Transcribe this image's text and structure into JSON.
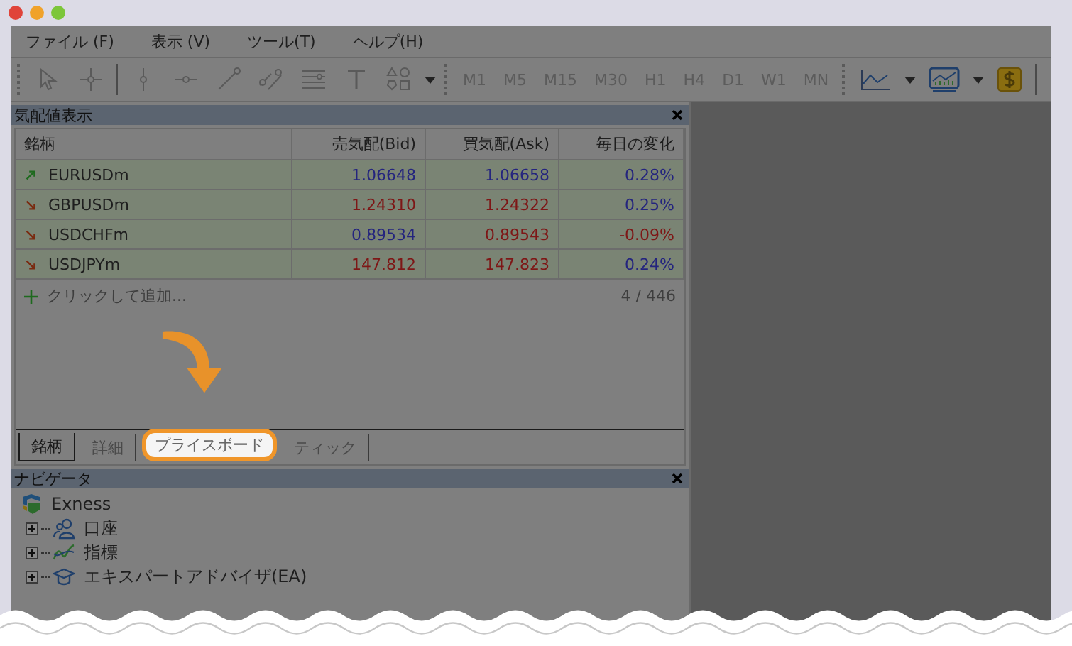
{
  "menu": [
    "ファイル (F)",
    "表示 (V)",
    "ツール(T)",
    "ヘルプ(H)"
  ],
  "toolbar": {
    "timeframes": [
      "M1",
      "M5",
      "M15",
      "M30",
      "H1",
      "H4",
      "D1",
      "W1",
      "MN"
    ]
  },
  "market_watch": {
    "title": "気配値表示",
    "columns": [
      "銘柄",
      "売気配(Bid)",
      "買気配(Ask)",
      "毎日の変化"
    ],
    "rows": [
      {
        "symbol": "EURUSDm",
        "rising": true,
        "bid": {
          "text": "1.06648",
          "rising": true
        },
        "ask": {
          "text": "1.06658",
          "rising": true
        },
        "change": {
          "text": "0.28%",
          "rising": true
        }
      },
      {
        "symbol": "GBPUSDm",
        "rising": false,
        "bid": {
          "text": "1.24310",
          "rising": false
        },
        "ask": {
          "text": "1.24322",
          "rising": false
        },
        "change": {
          "text": "0.25%",
          "rising": true
        }
      },
      {
        "symbol": "USDCHFm",
        "rising": false,
        "bid": {
          "text": "0.89534",
          "rising": true
        },
        "ask": {
          "text": "0.89543",
          "rising": false
        },
        "change": {
          "text": "-0.09%",
          "rising": false
        }
      },
      {
        "symbol": "USDJPYm",
        "rising": false,
        "bid": {
          "text": "147.812",
          "rising": false
        },
        "ask": {
          "text": "147.823",
          "rising": false
        },
        "change": {
          "text": "0.24%",
          "rising": true
        }
      }
    ],
    "add_label": "クリックして追加...",
    "count": "4 / 446",
    "tabs": [
      {
        "label": "銘柄",
        "selected": true,
        "highlighted": false
      },
      {
        "label": "詳細",
        "selected": false,
        "highlighted": false
      },
      {
        "label": "プライスボード",
        "selected": false,
        "highlighted": true
      },
      {
        "label": "ティック",
        "selected": false,
        "highlighted": false
      }
    ]
  },
  "navigator": {
    "title": "ナビゲータ",
    "root": "Exness",
    "children": [
      {
        "label": "口座",
        "kind": "accounts",
        "expanded": false
      },
      {
        "label": "指標",
        "kind": "indicators",
        "expanded": false
      },
      {
        "label": "エキスパートアドバイザ(EA)",
        "kind": "experts",
        "expanded": false
      }
    ]
  }
}
